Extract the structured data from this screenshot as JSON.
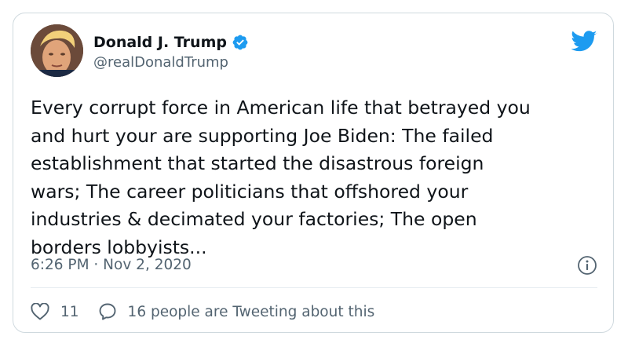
{
  "tweet": {
    "author": {
      "name": "Donald J. Trump",
      "handle": "@realDonaldTrump",
      "verified": true,
      "avatar_icon": "profile-photo"
    },
    "brand_icon": "twitter-bird-icon",
    "text": "Every corrupt force in American life that betrayed you\nand hurt your are supporting Joe Biden: The failed\nestablishment that started the disastrous foreign\nwars; The career politicians that offshored your\nindustries & decimated your factories; The open\nborders lobbyists...",
    "timestamp": "6:26 PM · Nov 2, 2020",
    "likes": "11",
    "conversation": "16 people are Tweeting about this"
  },
  "colors": {
    "brand_blue": "#1d9bf0",
    "text_primary": "#0f1419",
    "text_secondary": "#536471",
    "border": "#cfd9de"
  }
}
